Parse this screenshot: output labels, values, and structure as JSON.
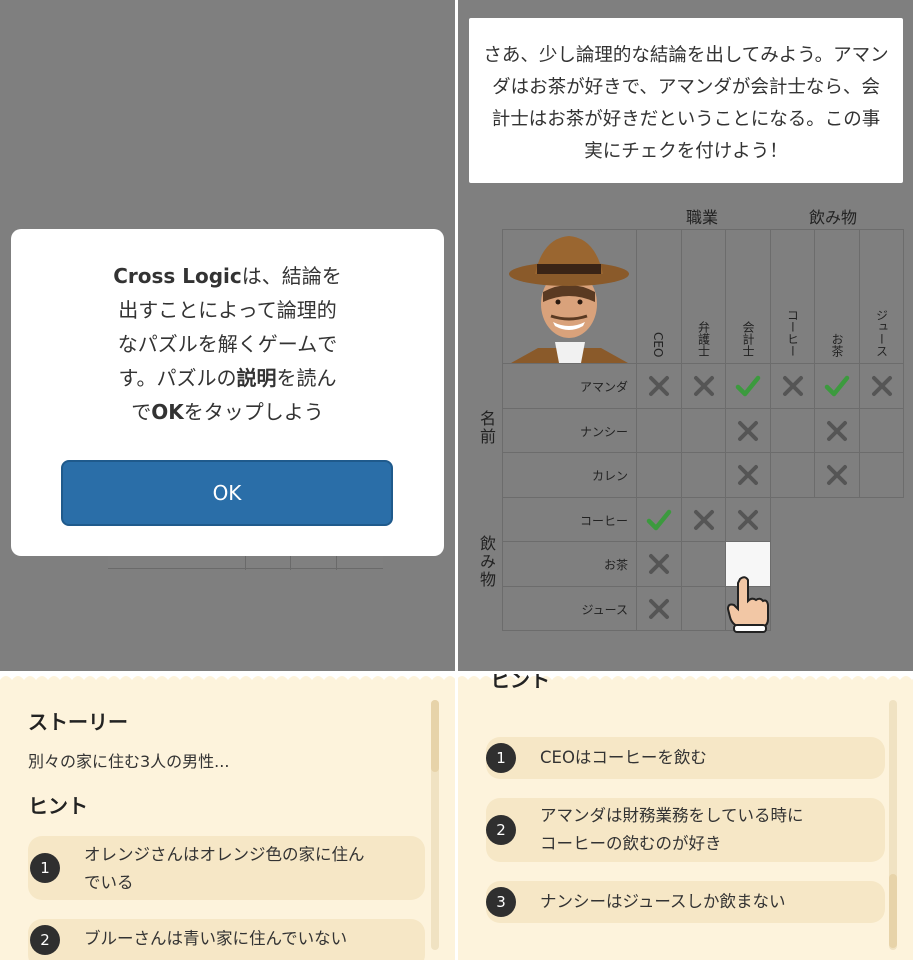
{
  "left_panel": {
    "modal": {
      "line1_bold": "Cross Logic",
      "line1_rest": "は、結論を",
      "line2": "出すことによって論理的",
      "line3": "なパズルを解くゲームで",
      "line4_a": "す。パズルの",
      "line4_bold": "説明",
      "line4_b": "を読ん",
      "line5_a": "で",
      "line5_bold": "OK",
      "line5_b": "をタップしよう",
      "ok_button": "OK"
    }
  },
  "right_panel": {
    "instruction": "さあ、少し論理的な結論を出してみよう。アマンダはお茶が好きで、アマンダが会計士なら、会計士はお茶が好きだということになる。この事実にチェクを付けよう！",
    "categories": {
      "job": "職業",
      "drink": "飲み物",
      "name": "名前",
      "drink_side": "飲み物"
    },
    "columns": [
      "CEO",
      "弁護士",
      "会計士",
      "コーヒー",
      "お茶",
      "ジュース"
    ],
    "rows": [
      "アマンダ",
      "ナンシー",
      "カレン",
      "コーヒー",
      "お茶",
      "ジュース"
    ],
    "marks": [
      [
        "x",
        "x",
        "check",
        "x",
        "check",
        "x"
      ],
      [
        "",
        "",
        "x",
        "",
        "x",
        ""
      ],
      [
        "",
        "",
        "x",
        "",
        "x",
        ""
      ],
      [
        "check",
        "x",
        "x"
      ],
      [
        "x",
        "",
        "selected"
      ],
      [
        "x",
        "",
        ""
      ]
    ],
    "colors": {
      "check": "#3c9a3e",
      "cross": "#555555",
      "grid_bg": "#7f7f7f"
    }
  },
  "bottom_left": {
    "story_title": "ストーリー",
    "story_text": "別々の家に住む3人の男性...",
    "hint_title": "ヒント",
    "hints": [
      {
        "num": "1",
        "line1": "オレンジさんはオレンジ色の家に住ん",
        "line2": "でいる"
      },
      {
        "num": "2",
        "line1": "ブルーさんは青い家に住んでいない",
        "line2": ""
      }
    ]
  },
  "bottom_right": {
    "hint_title_partial": "ヒント",
    "hints": [
      {
        "num": "1",
        "line1": "CEOはコーヒーを飲む",
        "line2": ""
      },
      {
        "num": "2",
        "line1": "アマンダは財務業務をしている時に",
        "line2": "コーヒーの飲むのが好き"
      },
      {
        "num": "3",
        "line1": "ナンシーはジュースしか飲まない",
        "line2": ""
      }
    ]
  }
}
